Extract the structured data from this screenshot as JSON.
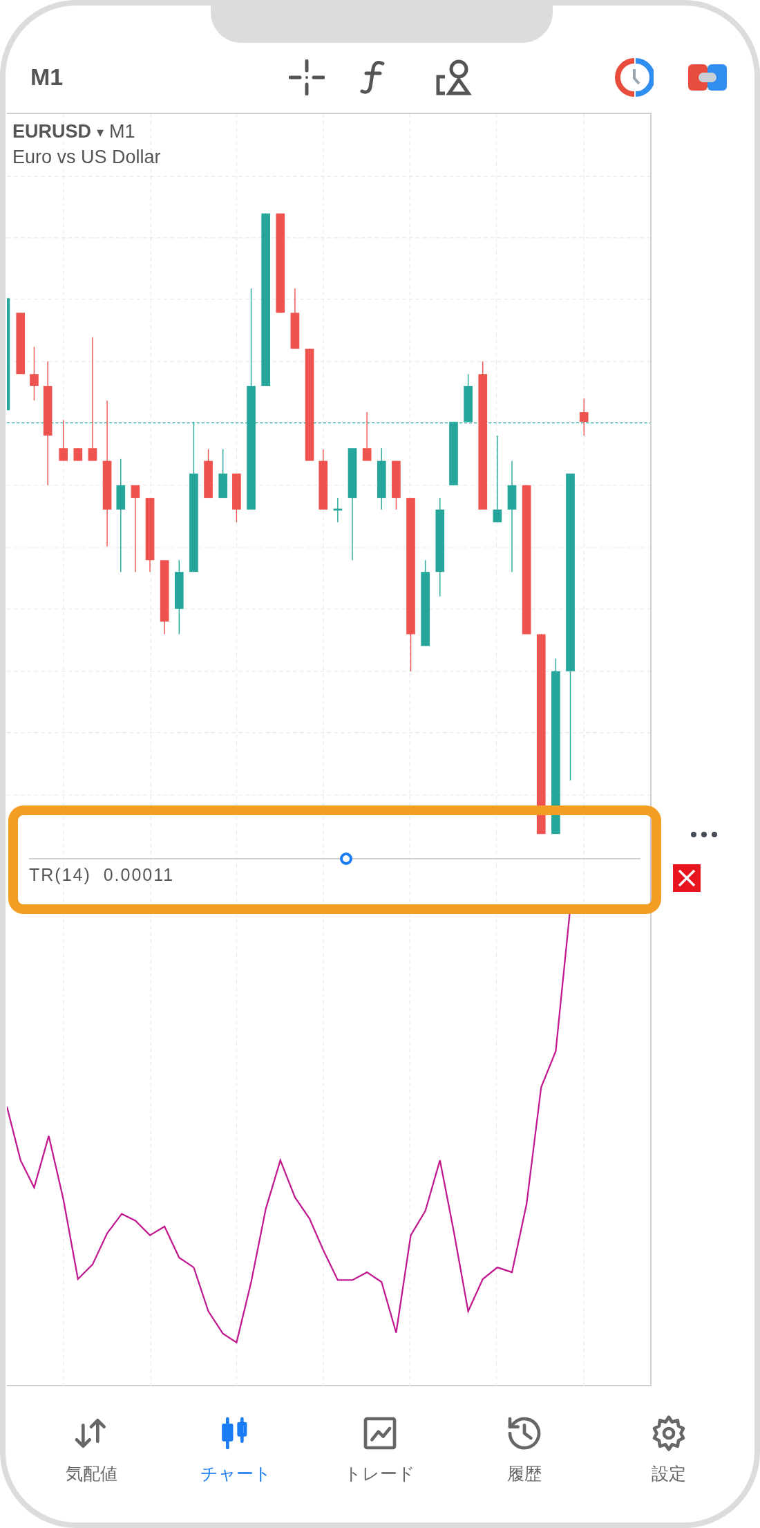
{
  "top_bar": {
    "timeframe": "M1"
  },
  "chart": {
    "symbol": "EURUSD",
    "caret": "▾",
    "timeframe": "M1",
    "description": "Euro vs US Dollar"
  },
  "indicator": {
    "label": "TR(14)",
    "value": "0.00011"
  },
  "tabs": [
    {
      "kind": "quotes",
      "label": "気配値",
      "selected": false
    },
    {
      "kind": "chart",
      "label": "チャート",
      "selected": true
    },
    {
      "kind": "trade",
      "label": "トレード",
      "selected": false
    },
    {
      "kind": "history",
      "label": "履歴",
      "selected": false
    },
    {
      "kind": "settings",
      "label": "設定",
      "selected": false
    }
  ]
}
